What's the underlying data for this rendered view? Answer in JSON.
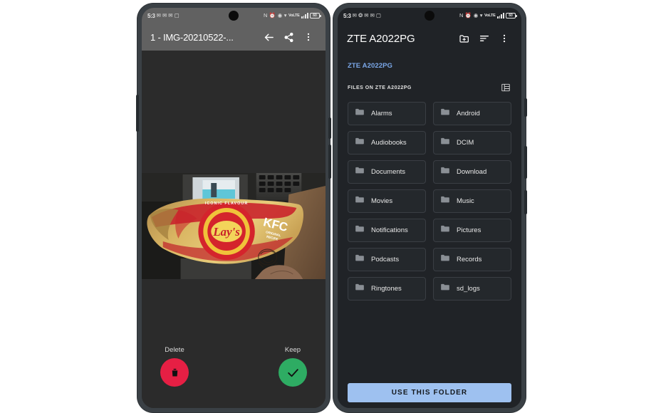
{
  "left_phone": {
    "status_bar": {
      "time": "5:3",
      "left_icons": [
        "message-icon",
        "message-icon",
        "message-icon",
        "sms-icon"
      ],
      "right_icons": [
        "nfc-icon",
        "alarm-icon",
        "dnd-icon",
        "wifi-icon"
      ],
      "volte_label": "VoLTE",
      "battery_level": "60"
    },
    "toolbar": {
      "title": "1 - IMG-20210522-...",
      "back_label": "back-arrow-icon",
      "share_label": "share-icon",
      "menu_label": "overflow-menu-icon"
    },
    "photo": {
      "alt": "Lay's KFC Original Recipe flavour chips bag held in hand"
    },
    "actions": {
      "delete_label": "Delete",
      "keep_label": "Keep",
      "delete_color": "#e61f44",
      "keep_color": "#2eac63"
    }
  },
  "right_phone": {
    "status_bar": {
      "time": "5:3",
      "left_icons": [
        "message-icon",
        "bluetooth-icon",
        "message-icon",
        "message-icon",
        "sms-icon"
      ],
      "right_icons": [
        "nfc-icon",
        "alarm-icon",
        "dnd-icon",
        "wifi-icon"
      ],
      "volte_label": "VoLTE",
      "battery_level": "60"
    },
    "toolbar": {
      "title": "ZTE A2022PG",
      "new_folder_label": "create-new-folder-icon",
      "sort_label": "sort-icon",
      "menu_label": "overflow-menu-icon"
    },
    "breadcrumb": {
      "label": "ZTE A2022PG",
      "color": "#7aa7e8"
    },
    "section": {
      "title": "FILES ON ZTE A2022PG",
      "view_toggle_label": "list-view-icon"
    },
    "folders": [
      {
        "name": "Alarms"
      },
      {
        "name": "Android"
      },
      {
        "name": "Audiobooks"
      },
      {
        "name": "DCIM"
      },
      {
        "name": "Documents"
      },
      {
        "name": "Download"
      },
      {
        "name": "Movies"
      },
      {
        "name": "Music"
      },
      {
        "name": "Notifications"
      },
      {
        "name": "Pictures"
      },
      {
        "name": "Podcasts"
      },
      {
        "name": "Records"
      },
      {
        "name": "Ringtones"
      },
      {
        "name": "sd_logs"
      }
    ],
    "footer": {
      "use_folder_label": "USE THIS FOLDER",
      "button_color": "#9ec1f0"
    }
  }
}
